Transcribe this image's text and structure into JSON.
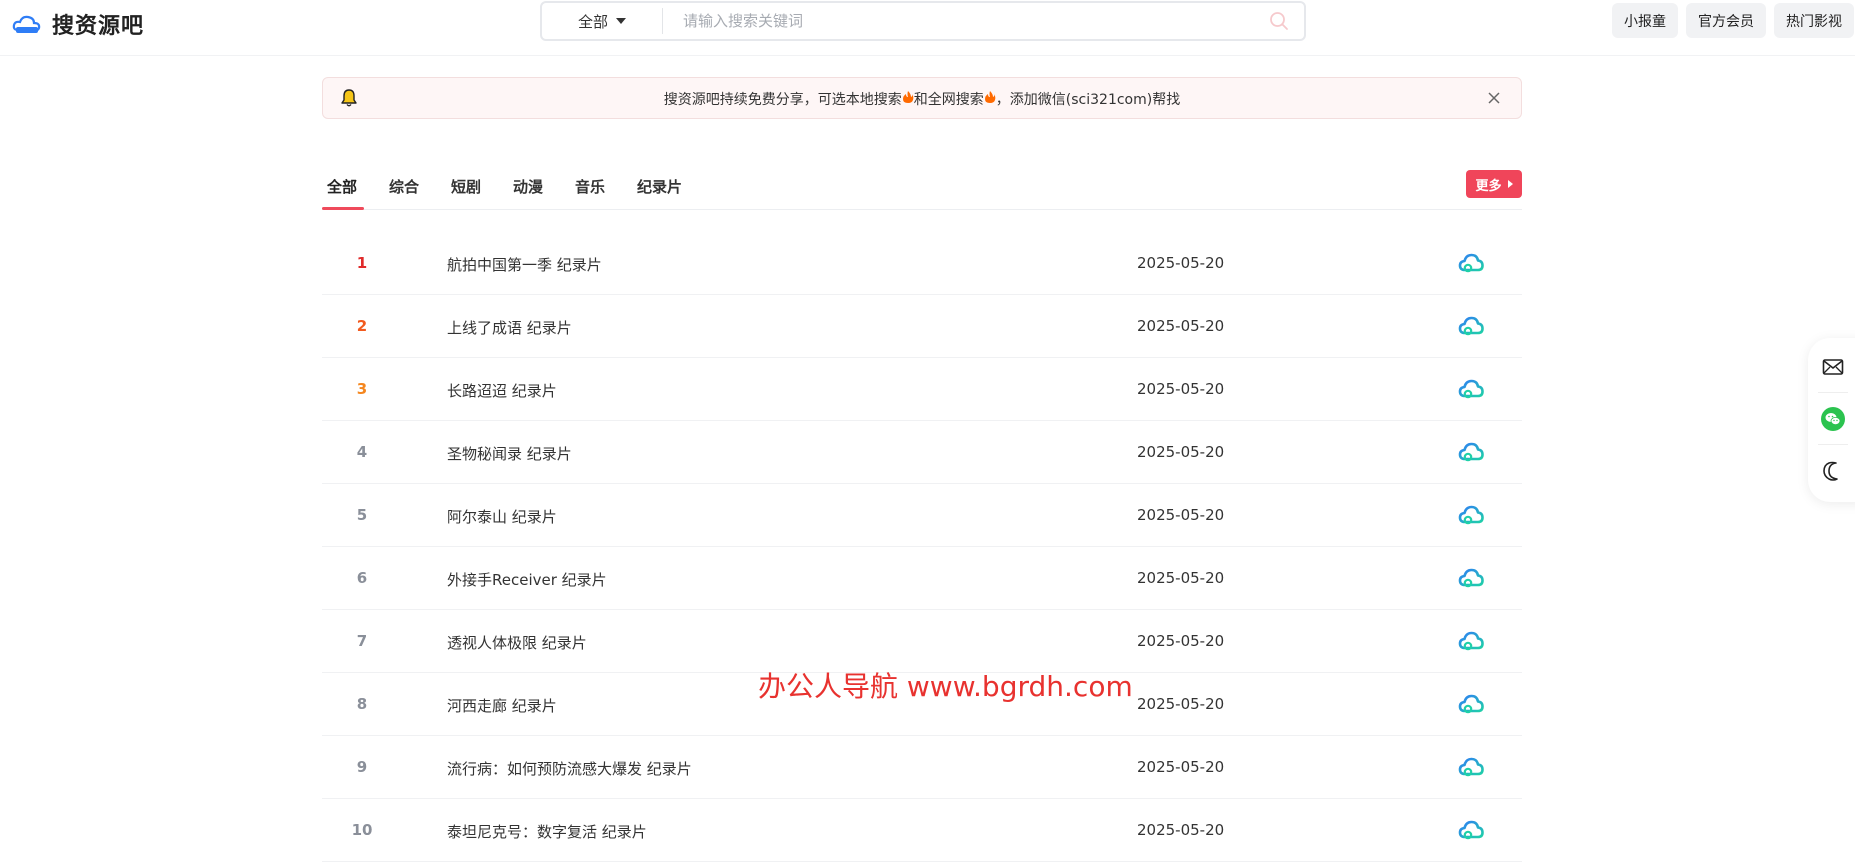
{
  "header": {
    "site_name": "搜资源吧",
    "search": {
      "category": "全部",
      "placeholder": "请输入搜索关键词"
    },
    "buttons": [
      "小报童",
      "官方会员",
      "热门影视"
    ]
  },
  "notice": {
    "text_part1": "搜资源吧持续免费分享，可选本地搜索",
    "text_part2": "和全网搜索",
    "text_part3": "，添加微信(sci321com)帮找"
  },
  "tabs": {
    "items": [
      "全部",
      "综合",
      "短剧",
      "动漫",
      "音乐",
      "纪录片"
    ],
    "more_label": "更多"
  },
  "list": [
    {
      "rank": "1",
      "title": "航拍中国第一季 纪录片",
      "date": "2025-05-20"
    },
    {
      "rank": "2",
      "title": "上线了成语 纪录片",
      "date": "2025-05-20"
    },
    {
      "rank": "3",
      "title": "长路迢迢 纪录片",
      "date": "2025-05-20"
    },
    {
      "rank": "4",
      "title": "圣物秘闻录 纪录片",
      "date": "2025-05-20"
    },
    {
      "rank": "5",
      "title": "阿尔泰山 纪录片",
      "date": "2025-05-20"
    },
    {
      "rank": "6",
      "title": "外接手Receiver 纪录片",
      "date": "2025-05-20"
    },
    {
      "rank": "7",
      "title": "透视人体极限 纪录片",
      "date": "2025-05-20"
    },
    {
      "rank": "8",
      "title": "河西走廊 纪录片",
      "date": "2025-05-20"
    },
    {
      "rank": "9",
      "title": "流行病：如何预防流感大爆发 纪录片",
      "date": "2025-05-20"
    },
    {
      "rank": "10",
      "title": "泰坦尼克号：数字复活 纪录片",
      "date": "2025-05-20"
    }
  ],
  "watermark": "办公人导航 www.bgrdh.com",
  "colors": {
    "accent": "#f0455a",
    "rank1": "#e02b2b",
    "rank2": "#f25a1e",
    "rank3": "#f5871f",
    "watermark": "#e8322f"
  },
  "icons": {
    "logo": "cloud-logo-icon",
    "search": "search-icon",
    "bell": "bell-icon",
    "close": "close-icon",
    "cloud_drive": "cloud-drive-icon",
    "mail": "mail-icon",
    "wechat": "wechat-icon",
    "dark_mode": "moon-icon"
  }
}
